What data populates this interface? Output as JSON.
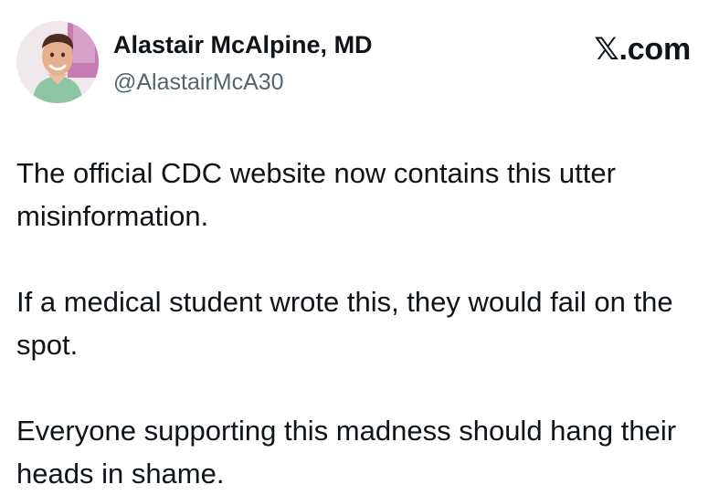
{
  "author": {
    "display_name": "Alastair McAlpine, MD",
    "handle": "@AlastairMcA30",
    "avatar_icon": "profile-photo"
  },
  "brand": {
    "label": "𝕏.com"
  },
  "post": {
    "paragraphs": [
      "The official CDC website now contains this utter misinformation.",
      "If a medical student wrote this, they would fail on the spot.",
      "Everyone supporting this madness should hang their heads in shame."
    ]
  },
  "colors": {
    "text": "#0f1419",
    "secondary_text": "#536471",
    "background": "#ffffff"
  }
}
